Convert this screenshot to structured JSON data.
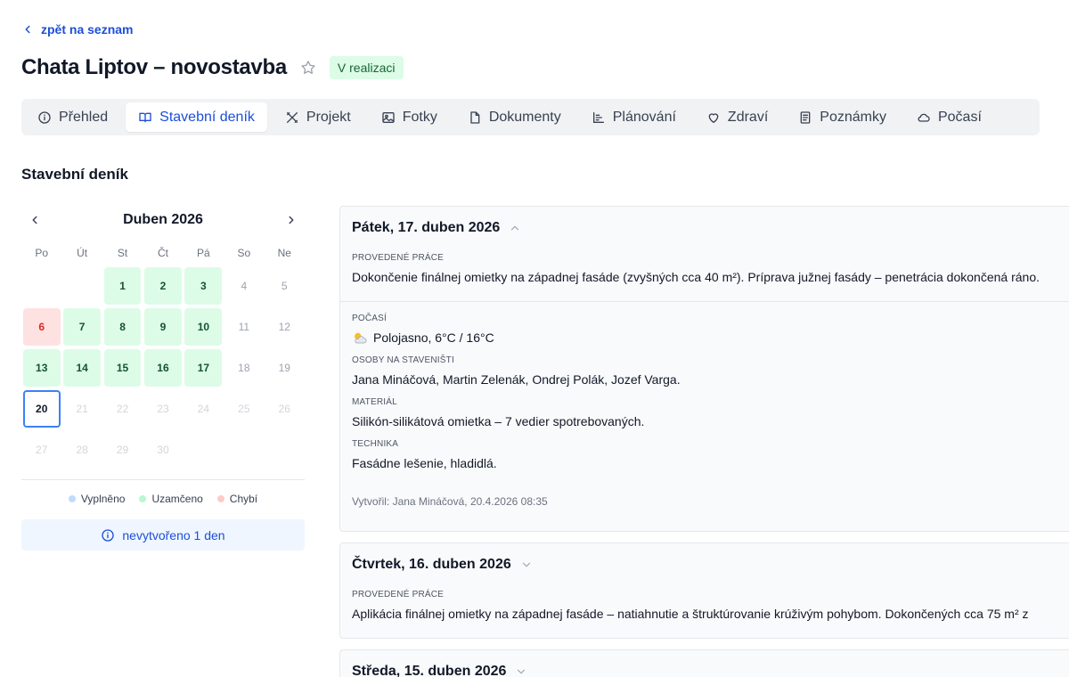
{
  "nav": {
    "back_label": "zpět na seznam"
  },
  "project": {
    "title": "Chata Liptov – novostavba",
    "status": "V realizaci"
  },
  "tabs": [
    {
      "label": "Přehled",
      "icon": "info-icon"
    },
    {
      "label": "Stavební deník",
      "icon": "book-icon"
    },
    {
      "label": "Projekt",
      "icon": "tools-icon"
    },
    {
      "label": "Fotky",
      "icon": "image-icon"
    },
    {
      "label": "Dokumenty",
      "icon": "file-icon"
    },
    {
      "label": "Plánování",
      "icon": "chart-icon"
    },
    {
      "label": "Zdraví",
      "icon": "heart-icon"
    },
    {
      "label": "Poznámky",
      "icon": "note-icon"
    },
    {
      "label": "Počasí",
      "icon": "cloud-icon"
    }
  ],
  "section_title": "Stavební deník",
  "calendar": {
    "month_label": "Duben 2026",
    "weekdays": [
      "Po",
      "Út",
      "St",
      "Čt",
      "Pá",
      "So",
      "Ne"
    ],
    "weeks": [
      [
        {
          "d": "",
          "s": "empty"
        },
        {
          "d": "",
          "s": "empty"
        },
        {
          "d": "1",
          "s": "filled"
        },
        {
          "d": "2",
          "s": "filled"
        },
        {
          "d": "3",
          "s": "filled"
        },
        {
          "d": "4",
          "s": "normal"
        },
        {
          "d": "5",
          "s": "normal"
        }
      ],
      [
        {
          "d": "6",
          "s": "missing"
        },
        {
          "d": "7",
          "s": "filled"
        },
        {
          "d": "8",
          "s": "filled"
        },
        {
          "d": "9",
          "s": "filled"
        },
        {
          "d": "10",
          "s": "filled"
        },
        {
          "d": "11",
          "s": "normal"
        },
        {
          "d": "12",
          "s": "normal"
        }
      ],
      [
        {
          "d": "13",
          "s": "filled"
        },
        {
          "d": "14",
          "s": "filled"
        },
        {
          "d": "15",
          "s": "filled"
        },
        {
          "d": "16",
          "s": "filled"
        },
        {
          "d": "17",
          "s": "filled"
        },
        {
          "d": "18",
          "s": "normal"
        },
        {
          "d": "19",
          "s": "normal"
        }
      ],
      [
        {
          "d": "20",
          "s": "today"
        },
        {
          "d": "21",
          "s": "future"
        },
        {
          "d": "22",
          "s": "future"
        },
        {
          "d": "23",
          "s": "future"
        },
        {
          "d": "24",
          "s": "future"
        },
        {
          "d": "25",
          "s": "future"
        },
        {
          "d": "26",
          "s": "future"
        }
      ],
      [
        {
          "d": "27",
          "s": "future"
        },
        {
          "d": "28",
          "s": "future"
        },
        {
          "d": "29",
          "s": "future"
        },
        {
          "d": "30",
          "s": "future"
        },
        {
          "d": "",
          "s": "empty"
        },
        {
          "d": "",
          "s": "empty"
        },
        {
          "d": "",
          "s": "empty"
        }
      ]
    ],
    "legend": [
      {
        "label": "Vyplněno",
        "color": "#bfdbfe"
      },
      {
        "label": "Uzamčeno",
        "color": "#bbf7d0"
      },
      {
        "label": "Chybí",
        "color": "#fecaca"
      }
    ],
    "notice": "nevytvořeno 1 den"
  },
  "entries": [
    {
      "date": "Pátek, 17. duben 2026",
      "expanded": true,
      "work_label": "PROVEDENÉ PRÁCE",
      "work": "Dokončenie finálnej omietky na západnej fasáde (zvyšných cca 40 m²). Príprava južnej fasády – penetrácia dokončená ráno.",
      "weather_label": "POČASÍ",
      "weather": "Polojasno, 6°C / 16°C",
      "people_label": "OSOBY NA STAVENIŠTI",
      "people": "Jana Mináčová, Martin Zelenák, Ondrej Polák, Jozef Varga.",
      "material_label": "MATERIÁL",
      "material": "Silikón-silikátová omietka – 7 vedier spotrebovaných.",
      "tech_label": "TECHNIKA",
      "tech": "Fasádne lešenie, hladidlá.",
      "created": "Vytvořil: Jana Mináčová, 20.4.2026 08:35"
    },
    {
      "date": "Čtvrtek, 16. duben 2026",
      "expanded": false,
      "work_label": "PROVEDENÉ PRÁCE",
      "work": "Aplikácia finálnej omietky na západnej fasáde – natiahnutie a štruktúrovanie krúživým pohybom. Dokončených cca 75 m² z"
    },
    {
      "date": "Středa, 15. duben 2026",
      "expanded": false
    }
  ],
  "colors": {
    "accent": "#1d4ed8",
    "filled": "#dcfce7",
    "missing": "#fee2e2",
    "today_border": "#3b82f6"
  }
}
